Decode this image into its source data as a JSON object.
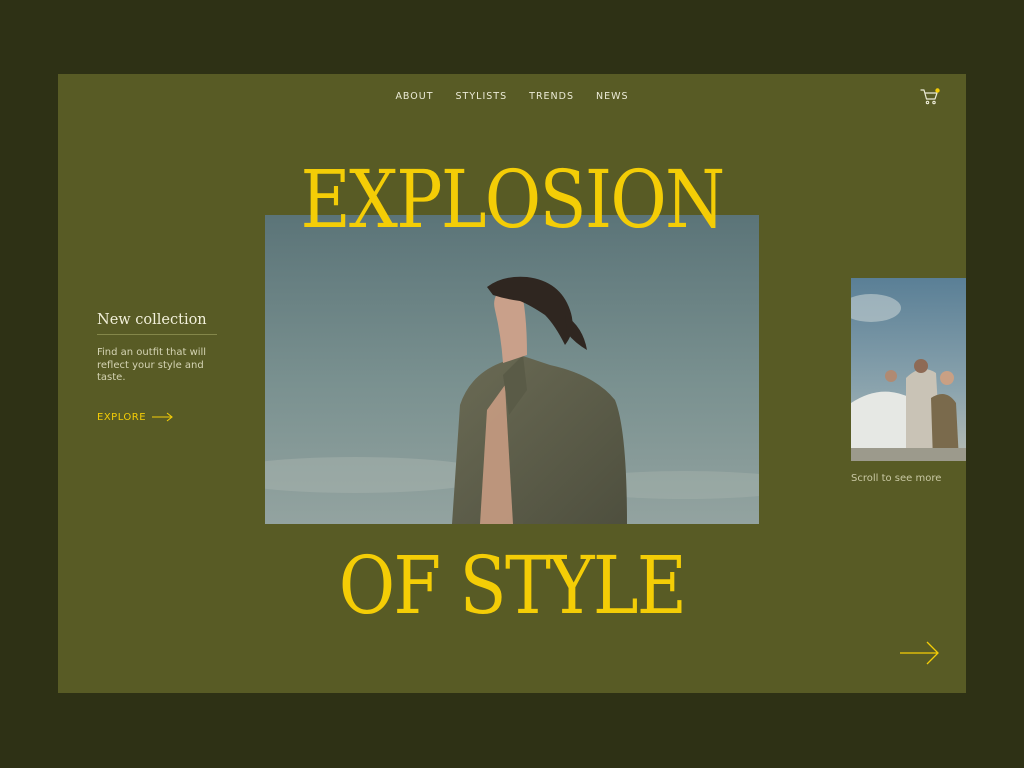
{
  "nav": {
    "items": [
      "ABOUT",
      "STYLISTS",
      "TRENDS",
      "NEWS"
    ]
  },
  "cart": {
    "icon": "cart-icon",
    "badge_color": "#f4cd06"
  },
  "headline": {
    "line1": "EXPLOSION",
    "line2": "OF STYLE"
  },
  "collection": {
    "title": "New collection",
    "description": "Find an outfit that will reflect your style and taste.",
    "cta": "EXPLORE"
  },
  "side": {
    "scroll_hint": "Scroll to see more"
  },
  "colors": {
    "background": "#2e3115",
    "panel": "#585b25",
    "accent": "#f4cd06"
  }
}
